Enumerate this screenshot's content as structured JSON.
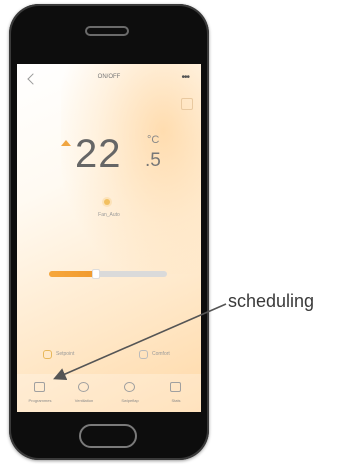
{
  "app": {
    "title": "ON/OFF",
    "temperature": {
      "integer": "22",
      "decimal": ".5",
      "unit": "°C"
    },
    "mode_label": "Fan_Auto",
    "fan_speed_fraction": 0.4,
    "chips": [
      {
        "icon": "clock-icon",
        "label": "Setpoint"
      },
      {
        "icon": "leaf-icon",
        "label": "Comfort"
      }
    ],
    "nav": [
      {
        "icon": "calendar-icon",
        "label": "Programmes"
      },
      {
        "icon": "fan-icon",
        "label": "Ventilation"
      },
      {
        "icon": "swing-icon",
        "label": "Swipeflap"
      },
      {
        "icon": "timer-icon",
        "label": "Stats"
      }
    ]
  },
  "annotation": {
    "label": "scheduling"
  },
  "colors": {
    "accent": "#f09a2e",
    "frame": "#0d0d0d",
    "text": "#666666"
  }
}
